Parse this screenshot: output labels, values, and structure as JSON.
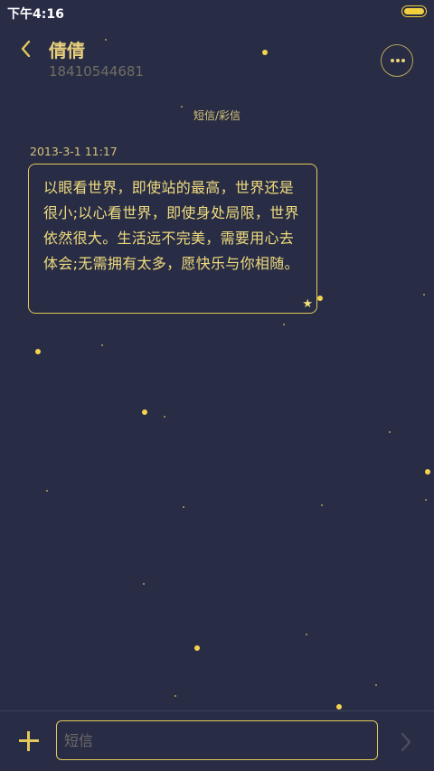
{
  "status_bar": {
    "time": "下午4:16"
  },
  "header": {
    "contact_name": "倩倩",
    "contact_phone": "18410544681"
  },
  "conversation": {
    "channel_label": "短信/彩信",
    "messages": [
      {
        "timestamp": "2013-3-1 11:17",
        "text": "以眼看世界，即使站的最高，世界还是很小;以心看世界，即使身处局限，世界依然很大。生活远不完美，需要用心去体会;无需拥有太多，愿快乐与你相随。",
        "starred_icon": "star-icon"
      }
    ]
  },
  "composer": {
    "placeholder": "短信"
  },
  "icons": {
    "back": "chevron-left-icon",
    "more": "more-dots-icon",
    "add": "plus-icon",
    "send": "chevron-right-icon"
  },
  "colors": {
    "background": "#282c45",
    "accent": "#e3c95b",
    "text": "#f0dc7e",
    "muted": "#6f6e66"
  }
}
